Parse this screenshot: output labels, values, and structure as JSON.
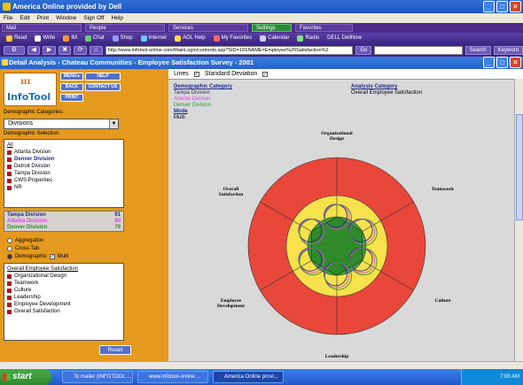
{
  "browser": {
    "title": "America Online provided by Dell",
    "menu": [
      "File",
      "Edit",
      "Print",
      "Window",
      "Sign Off",
      "Help"
    ],
    "aol_menus": [
      "Mail",
      "People",
      "Services",
      "Settings",
      "Favorites"
    ],
    "quick_buttons": [
      "Read",
      "Write",
      "IM",
      "Chat",
      "Shop",
      "Internet",
      "AOL Help",
      "My Favorites",
      "Calendar",
      "Radio",
      "DELL DellNow"
    ],
    "address": "http://www.infotool-online.com/MainLogin/contents.asp?SID=16SNAME=Employee%20Satisfaction%2",
    "go_label": "Go",
    "search_label": "Search",
    "keyword_label": "Keyword"
  },
  "window": {
    "title": "Detail Analysis - Chateau Communities - Employee Satisfaction Survey - 2001"
  },
  "sidebar": {
    "logo_text": "InfoTool",
    "buttons": [
      "MENU ▸",
      "HELP",
      "BACK",
      "CONTACT US",
      "PRINT"
    ],
    "demographic_categories_label": "Demographic Categories:",
    "selected_category": "Divisions",
    "demographic_selection_label": "Demographic Selection:",
    "selection_items": [
      "All",
      "Atlanta Division",
      "Denver Division",
      "Detroit Division",
      "Tampa Division",
      "CWS Properties",
      "NR"
    ],
    "summary": [
      {
        "name": "Tampa Division",
        "value": "91",
        "color": "#2a2a8a"
      },
      {
        "name": "Atlanta Division",
        "value": "80",
        "color": "#d44be0"
      },
      {
        "name": "Denver Division",
        "value": "79",
        "color": "#3a8a3a"
      }
    ],
    "options": [
      "Aggregation",
      "Cross-Tab",
      "Demographic",
      "Multi"
    ],
    "category_list_header": "Overall Employee Satisfaction",
    "category_list": [
      "Organizational Design",
      "Teamwork",
      "Culture",
      "Leadership",
      "Employee Development",
      "Overall Satisfaction"
    ],
    "reset_label": "Reset"
  },
  "content": {
    "lines_label": "Lines",
    "std_dev_label": "Standard Deviation",
    "demographic_category_title": "Demographic Category",
    "demographic_category_items": [
      "Tampa Division",
      "Atlanta Division",
      "Denver Division"
    ],
    "mode_title": "Mode",
    "mode_value": "Multi",
    "analysis_category_title": "Analysis Category",
    "analysis_category_value": "Overall Employee Satisfaction"
  },
  "chart": {
    "axes": [
      {
        "label": "Organizational Design",
        "angle": -90
      },
      {
        "label": "Teamwork",
        "angle": -30
      },
      {
        "label": "Culture",
        "angle": 30
      },
      {
        "label": "Leadership",
        "angle": 90
      },
      {
        "label": "Employee Development",
        "angle": 150
      },
      {
        "label": "Overall Satisfaction",
        "angle": 210
      }
    ],
    "ring_colors": {
      "outer": "#e8473a",
      "middle": "#f6e24a",
      "inner": "#3f9e3a"
    }
  },
  "taskbar": {
    "start_label": "start",
    "tasks": [
      "To mailer (INFOTOOL ...",
      "www.infotool-online ...",
      "America Online provi..."
    ],
    "tray_time": "7:08 AM"
  }
}
